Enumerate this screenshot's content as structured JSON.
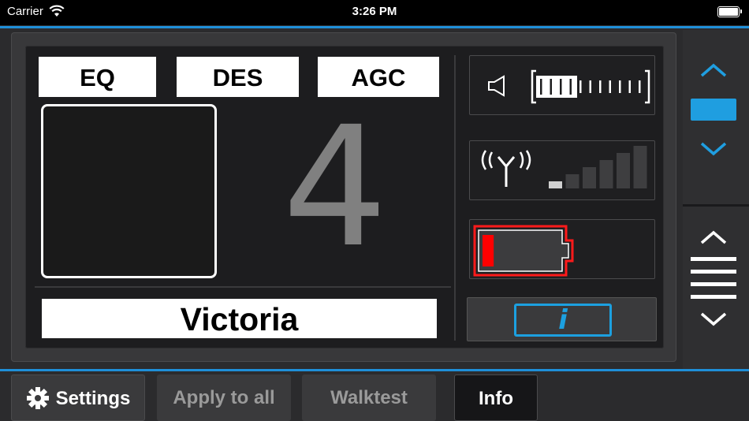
{
  "status_bar": {
    "carrier": "Carrier",
    "time": "3:26 PM",
    "battery_level": 1.0
  },
  "modes": {
    "eq_label": "EQ",
    "des_label": "DES",
    "agc_label": "AGC"
  },
  "channel_number": "4",
  "device_name": "Victoria",
  "volume": {
    "level_segments": 4,
    "total_segments": 11
  },
  "signal": {
    "active_bars": 1,
    "total_bars": 6
  },
  "battery": {
    "level": 0.12,
    "status_color": "#ff0000"
  },
  "info_button": {
    "label": "i"
  },
  "tabs": {
    "settings": "Settings",
    "apply": "Apply to all",
    "walktest": "Walktest",
    "info": "Info"
  },
  "colors": {
    "accent": "#1f9ee0",
    "battery_alert": "#ff0000"
  }
}
